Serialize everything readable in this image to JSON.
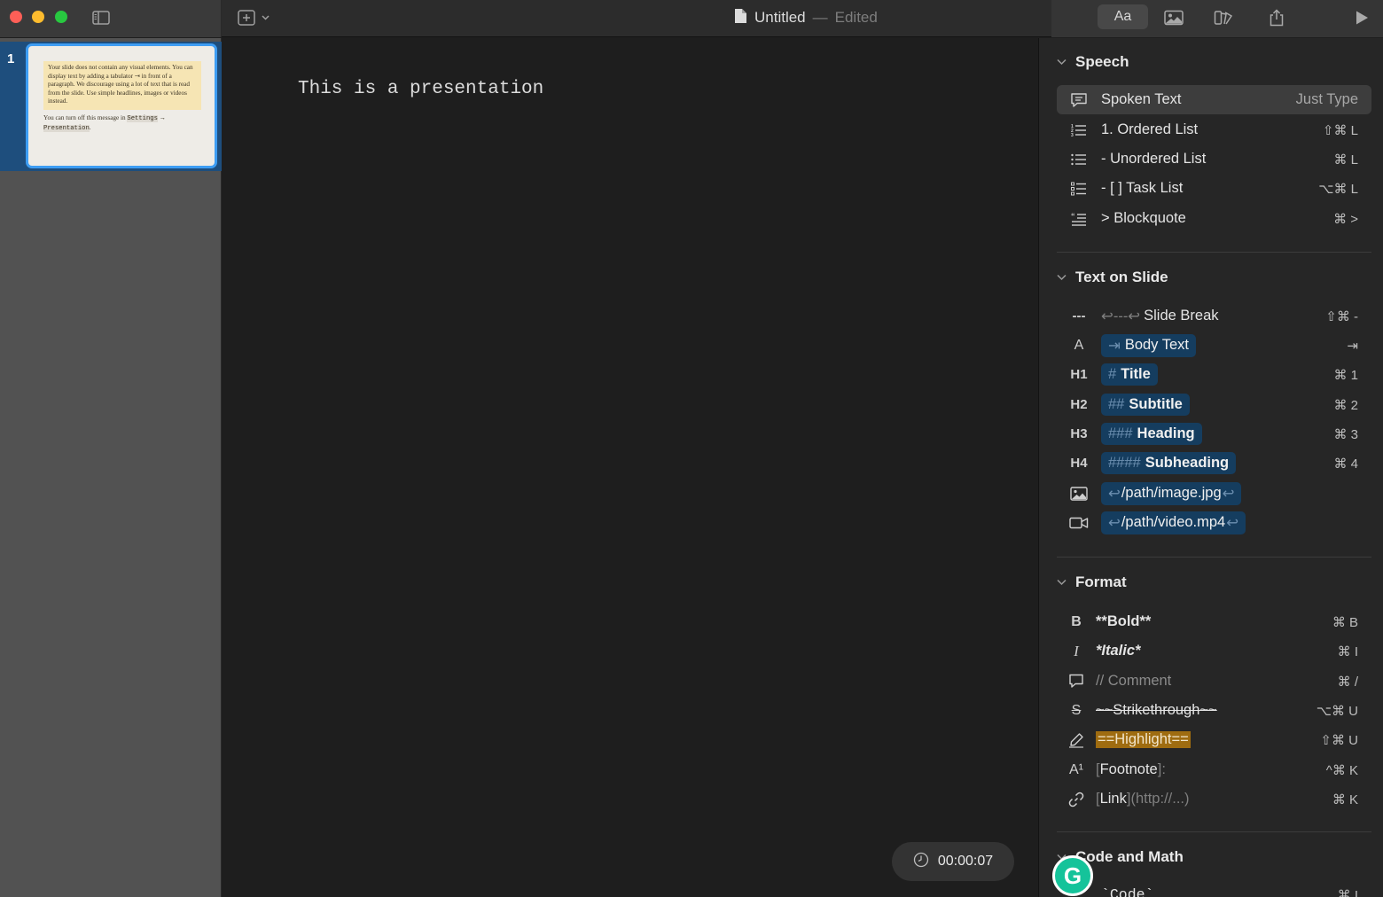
{
  "window": {
    "doc_name": "Untitled",
    "doc_separator": "—",
    "doc_status": "Edited",
    "font_button": "Aa"
  },
  "slides": {
    "items": [
      {
        "number": "1",
        "note": "Your slide does not contain any visual elements. You can display text by adding a tabulator ⇥ in front of a paragraph. We discourage using a lot of text that is read from the slide. Use simple headlines, images or videos instead.",
        "footer_prefix": "You can turn off this message in",
        "footer_code1": "Settings",
        "footer_arrow": "→",
        "footer_code2": "Presentation",
        "footer_end": "."
      }
    ]
  },
  "editor": {
    "text": "This is a presentation",
    "timer": "00:00:07"
  },
  "inspector": {
    "speech": {
      "title": "Speech",
      "rows": [
        {
          "label": "Spoken Text",
          "shortcut": "Just Type"
        },
        {
          "label": "1. Ordered List",
          "shortcut": "⇧⌘ L"
        },
        {
          "label": "- Unordered List",
          "shortcut": "⌘ L"
        },
        {
          "label": "- [ ] Task List",
          "shortcut": "⌥⌘ L"
        },
        {
          "label": "> Blockquote",
          "shortcut": "⌘ >"
        }
      ]
    },
    "text_on_slide": {
      "title": "Text on Slide",
      "slide_break": {
        "icon_text": "---",
        "prefix": "↩---↩",
        "label": "Slide Break",
        "shortcut": "⇧⌘ -"
      },
      "body_text": {
        "icon_text": "A",
        "prefix": "⇥",
        "label": "Body Text",
        "shortcut": "⇥"
      },
      "title_row": {
        "icon_text": "H1",
        "prefix": "#",
        "label": "Title",
        "shortcut": "⌘ 1"
      },
      "subtitle_row": {
        "icon_text": "H2",
        "prefix": "##",
        "label": "Subtitle",
        "shortcut": "⌘ 2"
      },
      "heading_row": {
        "icon_text": "H3",
        "prefix": "###",
        "label": "Heading",
        "shortcut": "⌘ 3"
      },
      "subheading_row": {
        "icon_text": "H4",
        "prefix": "####",
        "label": "Subheading",
        "shortcut": "⌘ 4"
      },
      "image_row": {
        "prefix": "↩",
        "label": "/path/image.jpg",
        "suffix": "↩"
      },
      "video_row": {
        "prefix": "↩",
        "label": "/path/video.mp4",
        "suffix": "↩"
      }
    },
    "format": {
      "title": "Format",
      "bold": {
        "icon_text": "B",
        "label": "**Bold**",
        "shortcut": "⌘ B"
      },
      "italic": {
        "icon_text": "I",
        "label": "*Italic*",
        "shortcut": "⌘ I"
      },
      "comment": {
        "label": "// Comment",
        "shortcut": "⌘ /"
      },
      "strike": {
        "icon_text": "S",
        "label": "~~Strikethrough~~",
        "shortcut": "⌥⌘ U"
      },
      "highlight": {
        "label": "==Highlight==",
        "shortcut": "⇧⌘ U"
      },
      "footnote": {
        "icon_text": "A¹",
        "open": "[",
        "label": "Footnote",
        "close": "]:",
        "shortcut": "^⌘ K"
      },
      "link": {
        "open": "[",
        "label": "Link",
        "close": "]",
        "url": "(http://...)",
        "shortcut": "⌘ K"
      }
    },
    "code_math": {
      "title": "Code and Math",
      "code_label": "`Code`",
      "code_shortcut": "⌘ I"
    }
  },
  "colors": {
    "accent": "#3d9df3",
    "pill": "#153d5f",
    "highlight": "#9f6c10",
    "grammarly": "#15c39a"
  }
}
